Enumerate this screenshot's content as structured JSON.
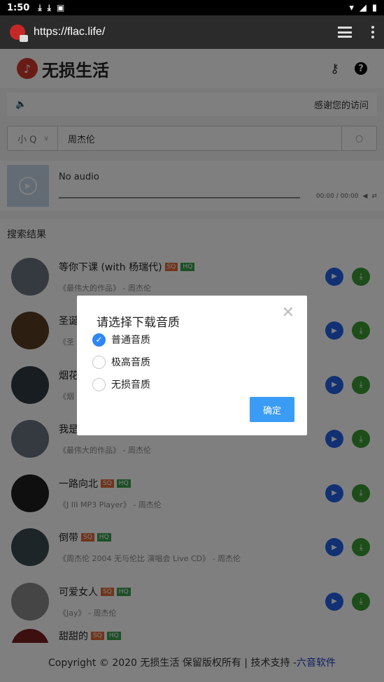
{
  "status_bar": {
    "time": "1:50"
  },
  "browser": {
    "url": "https://flac.life/"
  },
  "site": {
    "title": "无损生活",
    "notice": "感谢您的访问"
  },
  "search": {
    "source": "小 Q",
    "query": "周杰伦"
  },
  "player": {
    "status": "No audio",
    "time": "00:00 / 00:00"
  },
  "results": {
    "heading": "搜索结果",
    "items": [
      {
        "title": "等你下课 (with 杨瑞代)",
        "subtitle": "《最伟大的作品》 - 周杰伦",
        "sq": "SQ",
        "hq": "HQ"
      },
      {
        "title": "圣诞",
        "subtitle": "《圣",
        "sq": "",
        "hq": ""
      },
      {
        "title": "烟花",
        "subtitle": "《烟",
        "sq": "",
        "hq": ""
      },
      {
        "title": "我是",
        "subtitle": "《最伟大的作品》 - 周杰伦",
        "sq": "",
        "hq": ""
      },
      {
        "title": "一路向北",
        "subtitle": "《J III MP3 Player》 - 周杰伦",
        "sq": "SQ",
        "hq": "HQ"
      },
      {
        "title": "倒带",
        "subtitle": "《周杰伦 2004 无与伦比 演唱会 Live CD》 - 周杰伦",
        "sq": "SQ",
        "hq": "HQ"
      },
      {
        "title": "可爱女人",
        "subtitle": "《Jay》 - 周杰伦",
        "sq": "SQ",
        "hq": "HQ"
      },
      {
        "title": "甜甜的",
        "subtitle": "",
        "sq": "SQ",
        "hq": "HQ"
      }
    ]
  },
  "footer": {
    "text": "Copyright © 2020 无损生活 保留版权所有 | 技术支持 - ",
    "link": "六音软件"
  },
  "modal": {
    "title": "请选择下载音质",
    "options": [
      {
        "label": "普通音质",
        "checked": true
      },
      {
        "label": "极高音质",
        "checked": false
      },
      {
        "label": "无损音质",
        "checked": false
      }
    ],
    "confirm_label": "确定"
  },
  "colors": {
    "accent": "#2f86f6",
    "confirm_button": "#3b9cf5",
    "sq_tag": "#e06a3b",
    "hq_tag": "#3aa04c"
  }
}
